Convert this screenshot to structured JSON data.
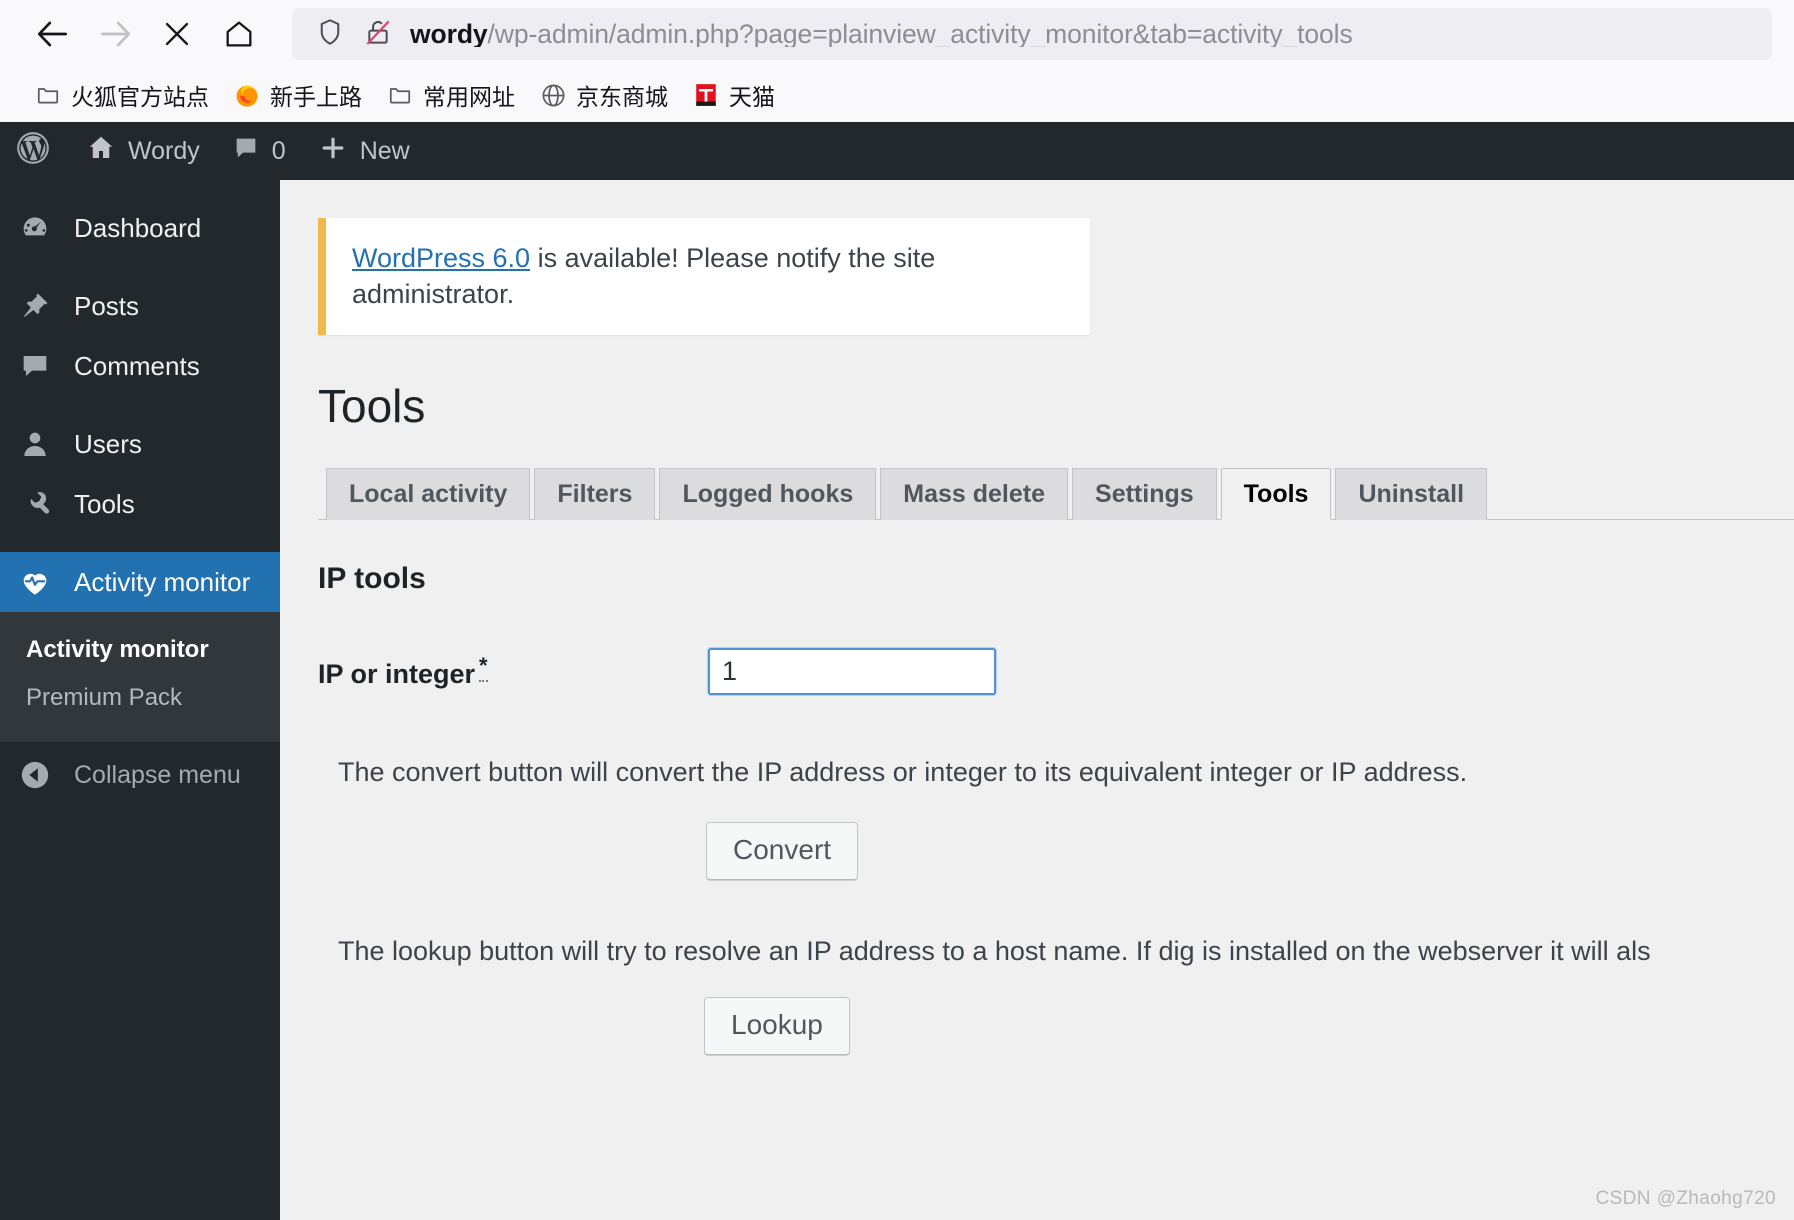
{
  "browser": {
    "nav": {
      "back_icon": "arrow-left-icon",
      "forward_icon": "arrow-right-icon",
      "stop_icon": "close-icon",
      "home_icon": "home-icon"
    },
    "url_host": "wordy",
    "url_path": "/wp-admin/admin.php?page=plainview_activity_monitor&tab=activity_tools",
    "url_full": "wordy/wp-admin/admin.php?page=plainview_activity_monitor&tab=activity_tools",
    "shield_icon": "shield-icon",
    "lock_broken_icon": "lock-broken-icon",
    "bookmarks": [
      {
        "label": "火狐官方站点",
        "icon": "folder-icon"
      },
      {
        "label": "新手上路",
        "icon": "firefox-icon"
      },
      {
        "label": "常用网址",
        "icon": "folder-icon"
      },
      {
        "label": "京东商城",
        "icon": "globe-icon"
      },
      {
        "label": "天猫",
        "icon": "tmall-icon"
      }
    ]
  },
  "adminbar": {
    "logo_icon": "wordpress-logo-icon",
    "site_icon": "home-icon",
    "site_name": "Wordy",
    "comments_icon": "comment-bubble-icon",
    "comments_count": "0",
    "new_icon": "plus-icon",
    "new_label": "New"
  },
  "sidebar": {
    "items": [
      {
        "label": "Dashboard",
        "icon": "dashboard-icon",
        "current": false
      },
      {
        "label": "Posts",
        "icon": "pin-icon",
        "current": false
      },
      {
        "label": "Comments",
        "icon": "comment-bubble-icon",
        "current": false
      },
      {
        "label": "Users",
        "icon": "user-icon",
        "current": false
      },
      {
        "label": "Tools",
        "icon": "wrench-icon",
        "current": false
      },
      {
        "label": "Activity monitor",
        "icon": "heartbeat-icon",
        "current": true
      }
    ],
    "submenu": [
      {
        "label": "Activity monitor",
        "current": true
      },
      {
        "label": "Premium Pack",
        "current": false
      }
    ],
    "collapse_label": "Collapse menu",
    "collapse_icon": "chevron-left-circle-icon"
  },
  "notice": {
    "link_text": "WordPress 6.0",
    "rest_text": " is available! Please notify the site administrator.",
    "accent_color": "#f0b849"
  },
  "page": {
    "title": "Tools",
    "tabs": [
      {
        "label": "Local activity",
        "active": false
      },
      {
        "label": "Filters",
        "active": false
      },
      {
        "label": "Logged hooks",
        "active": false
      },
      {
        "label": "Mass delete",
        "active": false
      },
      {
        "label": "Settings",
        "active": false
      },
      {
        "label": "Tools",
        "active": true
      },
      {
        "label": "Uninstall",
        "active": false
      }
    ],
    "section_heading": "IP tools",
    "field_label": "IP or integer",
    "field_required_mark": "*",
    "field_value": "1",
    "convert_desc": "The convert button will convert the IP address or integer to its equivalent integer or IP address.",
    "convert_button": "Convert",
    "lookup_desc": "The lookup button will try to resolve an IP address to a host name. If dig is installed on the webserver it will als",
    "lookup_button": "Lookup"
  },
  "watermark": "CSDN @Zhaohg720",
  "colors": {
    "wp_admin_dark": "#23282d",
    "wp_submenu_dark": "#32373c",
    "wp_current_blue": "#2271b1",
    "content_bg": "#f0f0f1",
    "link_blue": "#2271b1"
  }
}
